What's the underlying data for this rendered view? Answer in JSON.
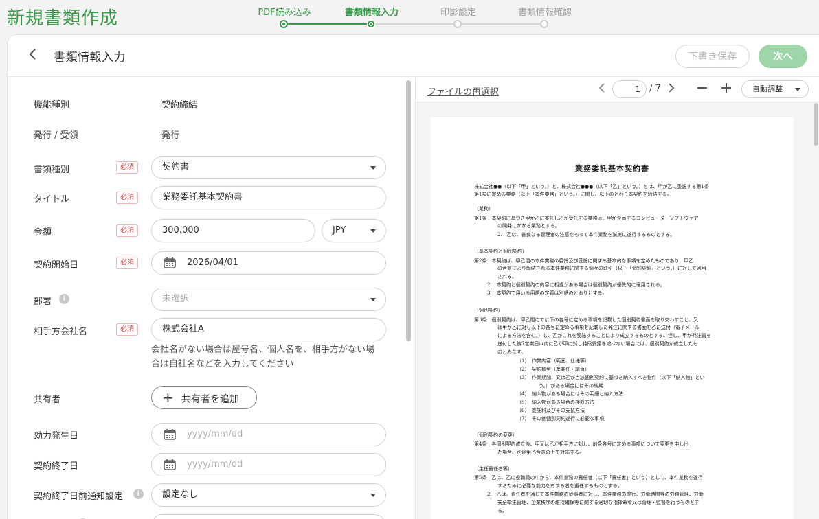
{
  "app_title": "新規書類作成",
  "stepper": {
    "steps": [
      {
        "label": "PDF読み込み",
        "state": "done"
      },
      {
        "label": "書類情報入力",
        "state": "current"
      },
      {
        "label": "印影設定",
        "state": "todo"
      },
      {
        "label": "書類情報確認",
        "state": "todo"
      }
    ]
  },
  "header": {
    "title": "書類情報入力",
    "draft_label": "下書き保存",
    "next_label": "次へ"
  },
  "form": {
    "function_type": {
      "label": "機能種別",
      "value": "契約締結"
    },
    "issue_receive": {
      "label": "発行 / 受領",
      "value": "発行"
    },
    "required_badge": "必須",
    "doc_type": {
      "label": "書類種別",
      "value": "契約書"
    },
    "title": {
      "label": "タイトル",
      "value": "業務委託基本契約書"
    },
    "amount": {
      "label": "金額",
      "value": "300,000",
      "currency": "JPY"
    },
    "start_date": {
      "label": "契約開始日",
      "value": "2026/04/01"
    },
    "department": {
      "label": "部署",
      "placeholder": "未選択"
    },
    "counterparty": {
      "label": "相手方会社名",
      "value": "株式会社A",
      "help_line1": "会社名がない場合は屋号名、個人名を、相手方がない場",
      "help_line2": "合は自社名などを入力してください"
    },
    "co_owner": {
      "label": "共有者",
      "button": "共有者を追加"
    },
    "effective_date": {
      "label": "効力発生日",
      "placeholder": "yyyy/mm/dd"
    },
    "end_date": {
      "label": "契約終了日",
      "placeholder": "yyyy/mm/dd"
    },
    "end_notice": {
      "label": "契約終了日前通知設定",
      "value": "設定なし"
    }
  },
  "viewer": {
    "reselect": "ファイルの再選択",
    "page": "1",
    "total": "/ 7",
    "zoom": "自動調整"
  },
  "pdf": {
    "title": "業務委託基本契約書",
    "lines": [
      "株式会社●●（以下「甲」という。）と、株式会社●●●（以下「乙」という。）とは、甲が乙に委託する第1条",
      "第1項に定める業務（以下「本件業務」という。）に関し、以下のとおり本契約を締結する。",
      "（業務）",
      "第1条　本契約に基づき甲が乙に委託し乙が受託する業務は、甲が企画するコンピューターソフトウェア",
      "の開発にかかる業務とする。",
      "2.　乙は、善良なる管理者の注意をもって本件業務を誠実に遂行するものとする。",
      "（基本契約と個別契約）",
      "第2条　本契約は、甲乙間の本件業務の委託及び受託に関する基本的な事項を定めたものであり、甲乙",
      "の合意により締結される本件業務に関する個々の取引（以下「個別契約」という。）に対して適用",
      "される。",
      "2.　本契約と個別契約の内容に相違がある場合は個別契約が優先的に適用される。",
      "3.　本契約で用いる用語の定義は別紙のとおりとする。",
      "（個別契約）",
      "第3条　個別契約は、甲乙間にて以下の各号に定める事項を記載した個別契約書面を取り交わすこと、又",
      "は甲が乙に対し以下の各号に定める事項を記載した発注に関する書面を乙に送付（電子メール",
      "による方法を含む。）し、乙がこれを受諾することにより成立するものとする。但し、甲が発注書を",
      "送付した後7営業日以内に乙が甲に対し特段異議を述べない場合には、個別契約が成立したも",
      "のとみなす。",
      "（1）　作業内容（範囲、仕様等）",
      "（2）　契約類型（準委任・請負）",
      "（3）　作業期間、又は乙が当該個別契約に基づき納入すべき物件（以下「納入物」とい",
      "う。）がある場合にはその納期",
      "（4）　納入物がある場合にはその明細と納入方法",
      "（5）　納入物がある場合の検収方法",
      "（6）　委託料及びその支払方法",
      "（7）　その他個別契約遂行に必要な事項",
      "（個別契約の変更）",
      "第4条　各個別契約成立後、甲又は乙が相手方に対し、前条各号に定める事項について変更を申し出",
      "た場合、別途甲乙合意の上で対応する。",
      "（主任責任者等）",
      "第5条　乙は、乙の役職員の中から、本件業務の責任者（以下「責任者」という）として、本件業務を遂行",
      "するために必要な能力を有する者を選任するものとする。",
      "2.　乙は、責任者を通じて本件業務の従事者に対し、本件業務の遂行、労働時間等の労務管理、労働",
      "安全衛生管理、企業秩序の維持確保等に関する適切な指揮命令又は管理・監督を行うものとす",
      "る。"
    ]
  }
}
